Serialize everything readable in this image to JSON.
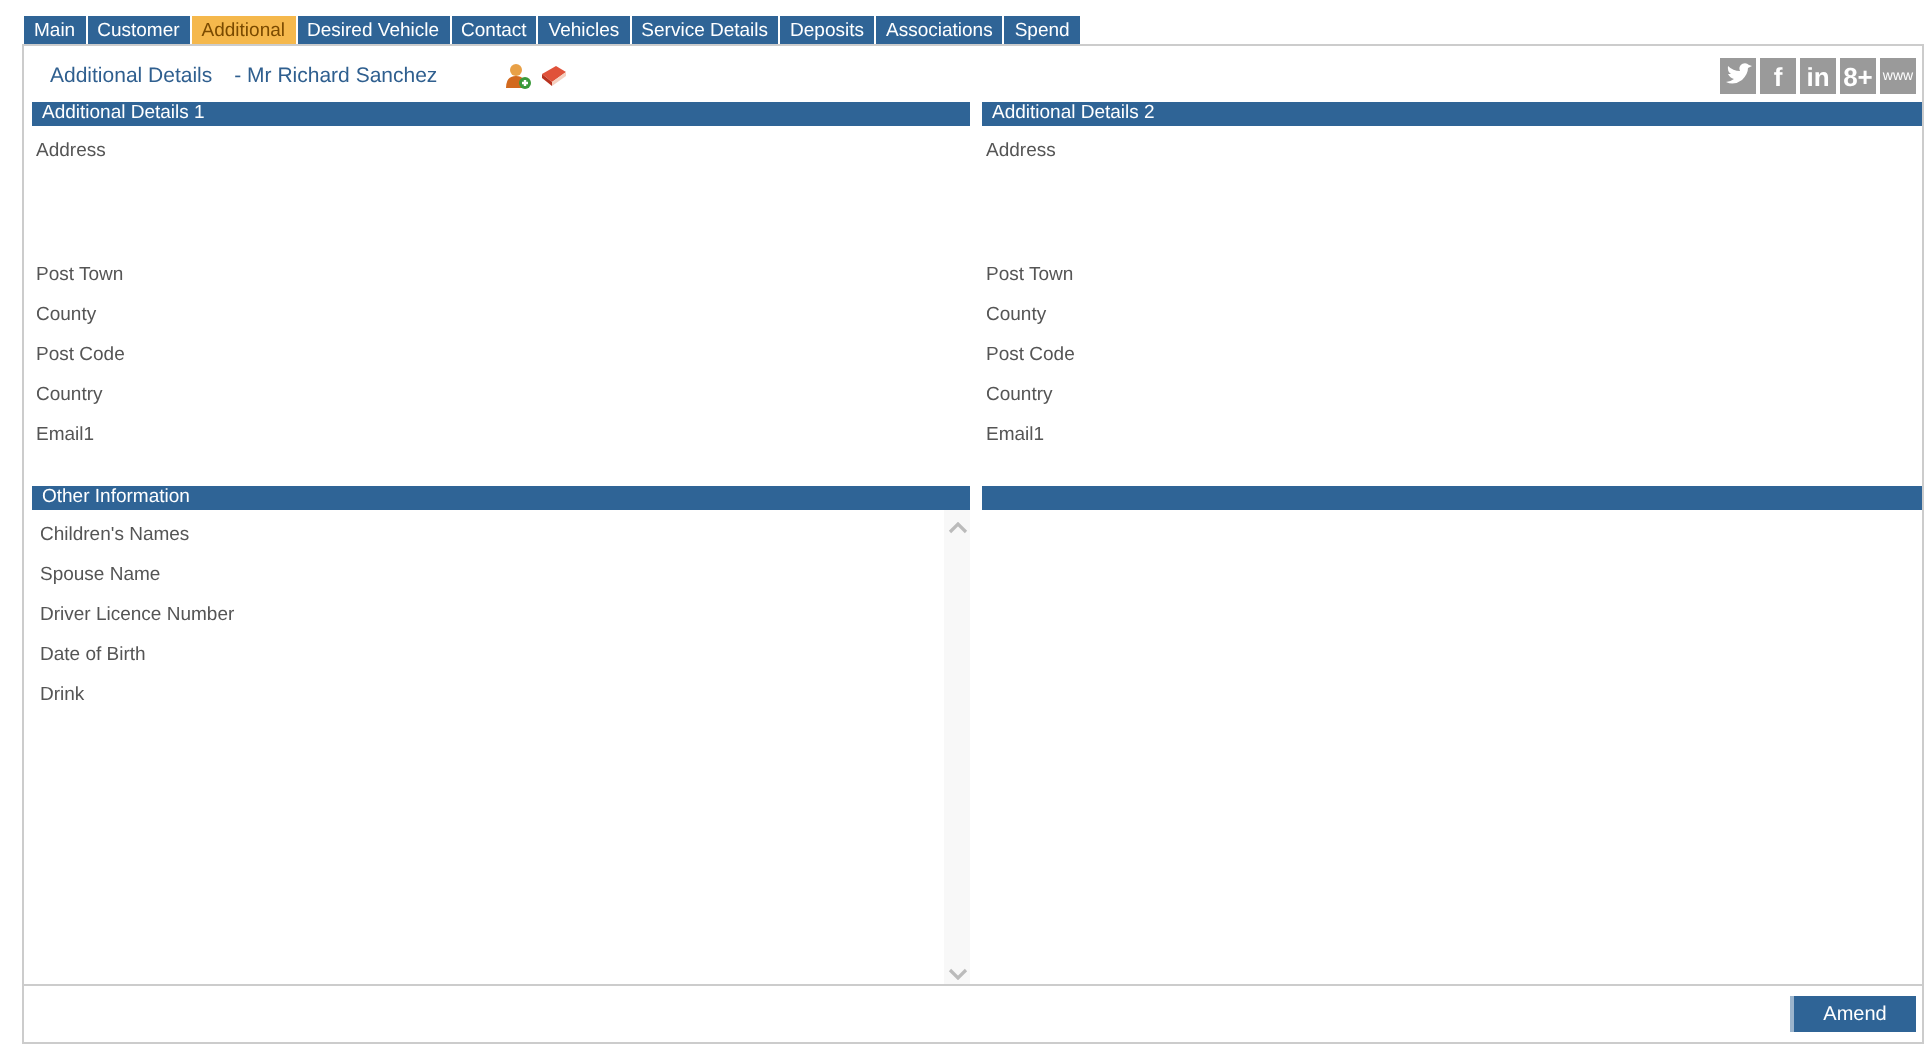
{
  "tabs": [
    {
      "label": "Main",
      "selected": false
    },
    {
      "label": "Customer",
      "selected": false
    },
    {
      "label": "Additional",
      "selected": true
    },
    {
      "label": "Desired Vehicle",
      "selected": false
    },
    {
      "label": "Contact",
      "selected": false
    },
    {
      "label": "Vehicles",
      "selected": false
    },
    {
      "label": "Service Details",
      "selected": false
    },
    {
      "label": "Deposits",
      "selected": false
    },
    {
      "label": "Associations",
      "selected": false
    },
    {
      "label": "Spend",
      "selected": false
    }
  ],
  "header": {
    "title": "Additional Details",
    "customer": "- Mr Richard Sanchez"
  },
  "social": [
    {
      "kind": "bird"
    },
    {
      "kind": "text",
      "label": "f"
    },
    {
      "kind": "text",
      "label": "in"
    },
    {
      "kind": "text",
      "label": "8+"
    },
    {
      "kind": "small",
      "label": "www"
    }
  ],
  "sections": [
    {
      "title": "Additional Details 1",
      "fields": [
        {
          "label": "Address",
          "kind": "multiline"
        },
        {
          "label": "Post Town",
          "kind": "line"
        },
        {
          "label": "County",
          "kind": "line"
        },
        {
          "label": "Post Code",
          "kind": "line"
        },
        {
          "label": "Country",
          "kind": "line"
        },
        {
          "label": "Email1",
          "kind": "line"
        }
      ]
    },
    {
      "title": "Additional Details 2",
      "fields": [
        {
          "label": "Address",
          "kind": "multiline"
        },
        {
          "label": "Post Town",
          "kind": "line"
        },
        {
          "label": "County",
          "kind": "line"
        },
        {
          "label": "Post Code",
          "kind": "line"
        },
        {
          "label": "Country",
          "kind": "line"
        },
        {
          "label": "Email1",
          "kind": "line"
        }
      ]
    }
  ],
  "other_information": {
    "title": "Other Information",
    "fields": [
      {
        "label": "Children's Names"
      },
      {
        "label": "Spouse Name"
      },
      {
        "label": "Driver Licence Number"
      },
      {
        "label": "Date of Birth"
      },
      {
        "label": "Drink"
      }
    ]
  },
  "buttons": [
    {
      "label": "Amend"
    }
  ]
}
